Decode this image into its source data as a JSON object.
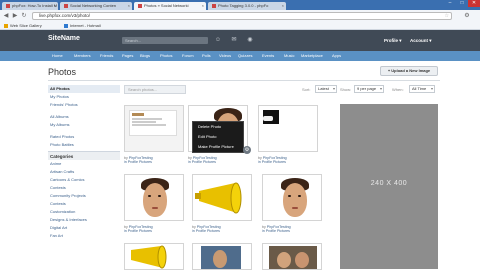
{
  "browser": {
    "tabs": [
      {
        "label": "phpFox: How-To Install M"
      },
      {
        "label": "Social Networking Conten"
      },
      {
        "label": "Photos » Social Networki"
      },
      {
        "label": "Photo Tagging 3.0.0 - phpFo"
      }
    ],
    "window_controls": {
      "minimize": "–",
      "maximize": "□",
      "close": "✕"
    },
    "url": "live.phpfox.com/v3/photo/",
    "bookmarks": [
      {
        "label": "Web Slice Gallery"
      },
      {
        "label": "Internet - Hotmail"
      }
    ]
  },
  "site": {
    "logo": "SiteName",
    "search_placeholder": "Search...",
    "header_links": {
      "profile": "Profile ▾",
      "account": "Account ▾"
    },
    "nav": [
      "Home",
      "Members",
      "Friends",
      "Pages",
      "Blogs",
      "Photos",
      "Forum",
      "Polls",
      "Videos",
      "Quizzes",
      "Events",
      "Music",
      "Marketplace",
      "Apps"
    ]
  },
  "page": {
    "title": "Photos",
    "upload_button": "+ Upload a New Image"
  },
  "sidebar": {
    "groups": [
      [
        "All Photos",
        "My Photos",
        "Friends' Photos"
      ],
      [
        "All Albums",
        "My Albums"
      ],
      [
        "Rated Photos",
        "Photo Battles"
      ]
    ],
    "categories_heading": "Categories",
    "categories": [
      "Anime",
      "Artisan Crafts",
      "Cartoons & Comics",
      "Contests",
      "Community Projects",
      "Contests",
      "Customization",
      "Designs & Interfaces",
      "Digital Art",
      "Fan Art"
    ]
  },
  "toolbar": {
    "filter_placeholder": "Search photos...",
    "sort_label": "Sort:",
    "sort_value": "Latest",
    "show_label": "Show:",
    "show_value": "9 per page",
    "when_label": "When:",
    "when_value": "All Time"
  },
  "photos": [
    {
      "by": "by",
      "user": "PhpFoxTesting",
      "album": "in Profile Pictures"
    },
    {
      "by": "by",
      "user": "PhpFoxTesting",
      "album": "in Profile Pictures"
    },
    {
      "by": "by",
      "user": "PhpFoxTesting",
      "album": "in Profile Pictures"
    },
    {
      "by": "by",
      "user": "PhpFoxTesting",
      "album": "in Profile Pictures"
    },
    {
      "by": "by",
      "user": "PhpFoxTesting",
      "album": "in Profile Pictures"
    },
    {
      "by": "by",
      "user": "PhpFoxTesting",
      "album": "in Profile Pictures"
    }
  ],
  "context_menu": [
    "Delete Photo",
    "Edit Photo",
    "Make Profile Picture"
  ],
  "ad": {
    "label": "240 X 400"
  },
  "icons": {
    "back": "back-icon",
    "forward": "forward-icon",
    "reload": "reload-icon",
    "star": "star-icon",
    "wrench": "wrench-icon",
    "gear": "gear-icon",
    "friends": "friends-icon",
    "mail": "mail-icon",
    "notifications": "notifications-icon"
  },
  "colors": {
    "header_bg": "#404a56",
    "nav_bg": "#5a91c4",
    "chrome_blue": "#3a6fb0",
    "ad_gray": "#8d8d8d",
    "menu_bg": "#1b1b1b"
  }
}
